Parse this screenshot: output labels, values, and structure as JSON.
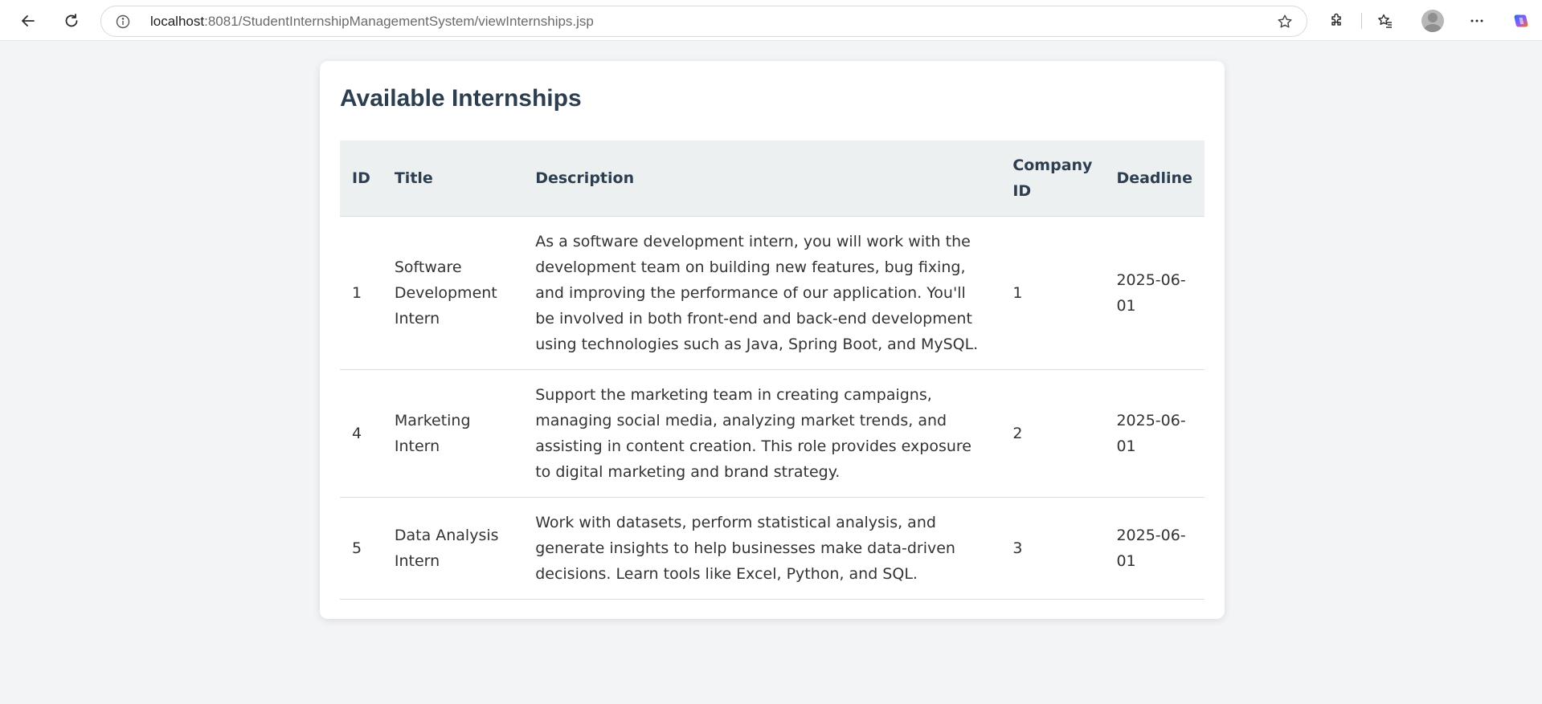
{
  "browser": {
    "url_host": "localhost",
    "url_rest": ":8081/StudentInternshipManagementSystem/viewInternships.jsp",
    "icons": {
      "back": "back-arrow-icon",
      "reload": "reload-icon",
      "info": "info-icon",
      "favorite": "star-icon",
      "extensions": "extensions-icon",
      "favorites": "favorites-icon",
      "profile": "avatar-icon",
      "more": "more-icon",
      "copilot": "copilot-icon"
    }
  },
  "page": {
    "title": "Available Internships",
    "colors": {
      "title": "#2c3e50",
      "header_bg": "#ecf0f1",
      "page_bg": "#f3f4f6"
    },
    "table": {
      "headers": {
        "id": "ID",
        "title": "Title",
        "description": "Description",
        "company_id": "Company ID",
        "deadline": "Deadline"
      },
      "rows": [
        {
          "id": "1",
          "title": "Software Development Intern",
          "description": "As a software development intern, you will work with the development team on building new features, bug fixing, and improving the performance of our application. You'll be involved in both front-end and back-end development using technologies such as Java, Spring Boot, and MySQL.",
          "company_id": "1",
          "deadline": "2025-06-01"
        },
        {
          "id": "4",
          "title": "Marketing Intern",
          "description": "Support the marketing team in creating campaigns, managing social media, analyzing market trends, and assisting in content creation. This role provides exposure to digital marketing and brand strategy.",
          "company_id": "2",
          "deadline": "2025-06-01"
        },
        {
          "id": "5",
          "title": "Data Analysis Intern",
          "description": "Work with datasets, perform statistical analysis, and generate insights to help businesses make data-driven decisions. Learn tools like Excel, Python, and SQL.",
          "company_id": "3",
          "deadline": "2025-06-01"
        }
      ]
    }
  }
}
